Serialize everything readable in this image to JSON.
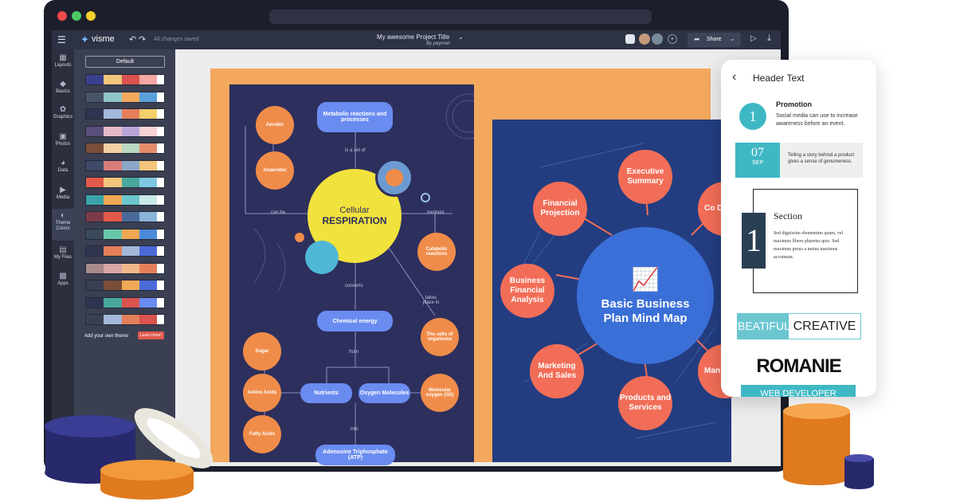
{
  "app": {
    "logo": "visme",
    "saved_status": "All changes saved",
    "project_title": "My awesome Project Title",
    "author": "By payman",
    "share_label": "Share"
  },
  "sidebar": {
    "tools": [
      {
        "label": "Layouts",
        "icon": "layouts-icon"
      },
      {
        "label": "Basics",
        "icon": "basics-icon"
      },
      {
        "label": "Graphics",
        "icon": "graphics-icon"
      },
      {
        "label": "Photos",
        "icon": "photos-icon"
      },
      {
        "label": "Data",
        "icon": "data-icon"
      },
      {
        "label": "Media",
        "icon": "media-icon"
      },
      {
        "label": "Theme Colors",
        "icon": "palette-icon"
      },
      {
        "label": "My Files",
        "icon": "folder-icon"
      },
      {
        "label": "Apps",
        "icon": "apps-icon"
      }
    ]
  },
  "themes": {
    "default_label": "Default",
    "add_own": "Add your own theme",
    "learn_more": "Learn more!",
    "palettes": [
      [
        "#3a3f8f",
        "#f2c57c",
        "#d9534f",
        "#f4a7a3",
        "#ffffff"
      ],
      [
        "#4a5468",
        "#8ec6c5",
        "#f3a85d",
        "#5aa0d8",
        "#ffffff"
      ],
      [
        "#2f3550",
        "#a3b8d8",
        "#e57f5a",
        "#f2d06b",
        "#ffffff"
      ],
      [
        "#5a4e7c",
        "#e7b8c8",
        "#b9a5d8",
        "#f7d2d5",
        "#ffffff"
      ],
      [
        "#7a4e3a",
        "#f2d0a4",
        "#b9d8c2",
        "#e58c6b",
        "#ffffff"
      ],
      [
        "#3d4a68",
        "#d97c7c",
        "#8aa7c8",
        "#f3c47c",
        "#ffffff"
      ],
      [
        "#e25a4a",
        "#f2c57c",
        "#4aa89a",
        "#7ec8e3",
        "#ffffff"
      ],
      [
        "#3aa3a8",
        "#f0a855",
        "#6ac6cc",
        "#c9e8e8",
        "#ffffff"
      ],
      [
        "#7c3a4a",
        "#e25a4a",
        "#4a6a9a",
        "#8ab4d8",
        "#ffffff"
      ],
      [
        "#3a4a5a",
        "#6ac6a8",
        "#f0a855",
        "#4a8ad8",
        "#ffffff"
      ],
      [
        "#2f3550",
        "#e57f5a",
        "#a3b8d8",
        "#4a6ad8",
        "#ffffff"
      ],
      [
        "#a88a8a",
        "#d9a5a5",
        "#f0b88a",
        "#e57f5a",
        "#ffffff"
      ],
      [
        "#3a3f51",
        "#7a4e3a",
        "#f0a855",
        "#4a6ad8",
        "#ffffff"
      ],
      [
        "#2f3550",
        "#4aa89a",
        "#d9534f",
        "#6a8cf0",
        "#ffffff"
      ],
      [
        "#3a3f51",
        "#a3b8d8",
        "#e57f5a",
        "#d9534f",
        "#ffffff"
      ]
    ]
  },
  "respiration_map": {
    "center_line1": "Cellular",
    "center_line2": "RESPIRATION",
    "top_pill": "Metabolic reactions and processes",
    "is_a_set_of": "is a set of",
    "can_be": "can be",
    "involves": "involves",
    "converts": "converts",
    "takes_place_in": "takes place in",
    "from": "from",
    "into": "into",
    "aerobic": "Aerobic",
    "anaerobic": "Anaerobic",
    "catabolic": "Catabolic reactions",
    "chemical_energy": "Chemical energy",
    "cells": "The cells of organisms",
    "sugar": "Sugar",
    "amino_acids": "Amino Acids",
    "fatty_acids": "Fatty Acids",
    "nutrients": "Nutrients",
    "oxygen_molecules": "Oxygen Molecules",
    "molecular_oxygen": "Molecular oxygen (O2)",
    "atp": "Adenosine Triphosphate (ATP)"
  },
  "business_map": {
    "center_line1": "Basic Business",
    "center_line2": "Plan Mind Map",
    "executive_summary": "Executive Summary",
    "financial_projection": "Financial Projection",
    "business_financial_analysis": "Business Financial Analysis",
    "marketing_sales": "Marketing And Sales",
    "products_services": "Products and Services",
    "company_description_partial": "Co Des",
    "management_partial": "Man St"
  },
  "mobile": {
    "header": "Header Text",
    "promo_number": "1",
    "promo_title": "Promotion",
    "promo_text": "Social media can use to increase awareness before an event.",
    "date_day": "07",
    "date_month": "SEP",
    "date_text": "Telling a story behind a product gives a sense of genuineness.",
    "section_number": "1",
    "section_title": "Section",
    "section_body": "Sed dignissim elementum quam, vel maximus libero pharetra quis. Sed maximus purus a metus maximus accumsan.",
    "beatiful": "BEATIFUL",
    "creative": "CREATIVE",
    "romanie": "ROMANIE",
    "web_developer": "WEB DEVELOPER"
  }
}
